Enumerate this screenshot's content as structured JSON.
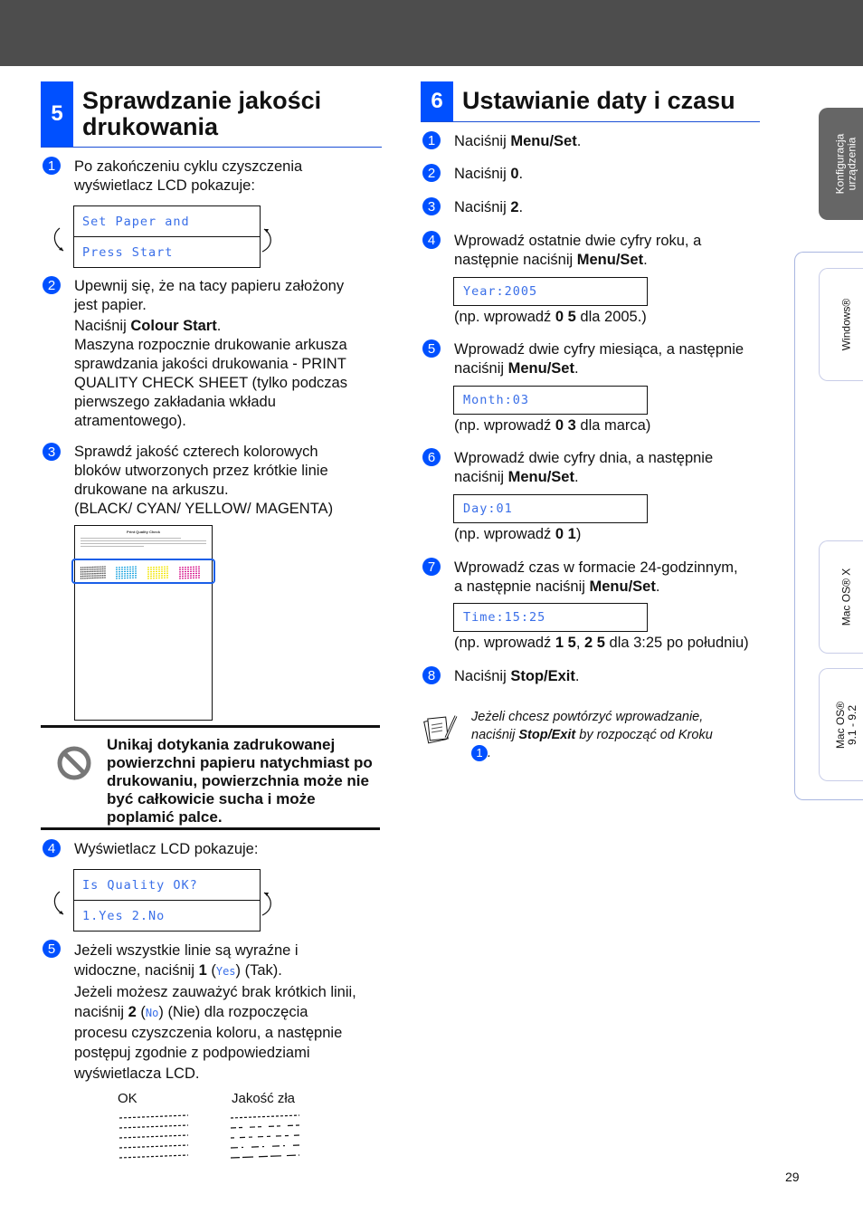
{
  "page_number": "29",
  "section5": {
    "number": "5",
    "title_line1": "Sprawdzanie jakości",
    "title_line2": "drukowania",
    "steps": [
      {
        "badge": "1",
        "lines": [
          "Po zakończeniu cyklu czyszczenia",
          "wyświetlacz LCD pokazuje:"
        ]
      },
      {
        "badge": "2",
        "line1": "Upewnij się, że na tacy papieru założony",
        "line2": "jest papier.",
        "press_prefix": "Naciśnij ",
        "press_key": "Colour Start",
        "press_suffix": ".",
        "rest": [
          "Maszyna rozpocznie drukowanie arkusza",
          "sprawdzania jakości drukowania - PRINT",
          "QUALITY CHECK SHEET (tylko podczas",
          "pierwszego zakładania wkładu",
          "atramentowego)."
        ]
      },
      {
        "badge": "3",
        "lines": [
          "Sprawdź jakość czterech kolorowych",
          "bloków utworzonych przez krótkie linie",
          "drukowane na arkuszu.",
          "(BLACK/ CYAN/ YELLOW/ MAGENTA)"
        ]
      },
      {
        "badge": "4",
        "lines": [
          "Wyświetlacz LCD pokazuje:"
        ]
      },
      {
        "badge": "5",
        "l1": "Jeżeli wszystkie linie są wyraźne i",
        "l2_pre": "widoczne, naciśnij ",
        "l2_key": "1",
        "l2_open": " (",
        "l2_lcd": "Yes",
        "l2_post": ") (Tak).",
        "l3": "Jeżeli możesz zauważyć brak krótkich linii,",
        "l4_pre": "naciśnij ",
        "l4_key": "2",
        "l4_open": " (",
        "l4_lcd": "No",
        "l4_post": ") (Nie) dla rozpoczęcia",
        "l5": "procesu czyszczenia koloru, a następnie",
        "l6": "postępuj zgodnie z podpowiedziami",
        "l7": "wyświetlacza LCD."
      }
    ],
    "lcd1": [
      "Set Paper and",
      "Press Start"
    ],
    "lcd2": [
      "Is Quality OK?",
      "1.Yes 2.No"
    ],
    "sheet_title": "Print Quality Check",
    "warning": [
      "Unikaj dotykania zadrukowanej",
      "powierzchni papieru natychmiast po",
      "drukowaniu, powierzchnia może nie",
      "być całkowicie sucha i może",
      "poplamić palce."
    ],
    "ok_label": "OK",
    "bad_label": "Jakość zła",
    "colors": {
      "black": "#111111",
      "cyan": "#1aa3e0",
      "yellow": "#f2e600",
      "magenta": "#d6148c"
    }
  },
  "section6": {
    "number": "6",
    "title": "Ustawianie daty i czasu",
    "steps": [
      {
        "badge": "1",
        "pre": "Naciśnij ",
        "key": "Menu/Set",
        "post": "."
      },
      {
        "badge": "2",
        "pre": "Naciśnij ",
        "key": "0",
        "post": "."
      },
      {
        "badge": "3",
        "pre": "Naciśnij ",
        "key": "2",
        "post": "."
      },
      {
        "badge": "4",
        "line1": "Wprowadź ostatnie dwie cyfry roku, a",
        "pre": "następnie naciśnij ",
        "key": "Menu/Set",
        "post": ".",
        "lcd": "Year:2005",
        "ex_pre": "(np. wprowadź ",
        "ex_key": "0 5",
        "ex_post": " dla 2005.)"
      },
      {
        "badge": "5",
        "line1": "Wprowadź dwie cyfry miesiąca, a następnie",
        "pre": "naciśnij ",
        "key": "Menu/Set",
        "post": ".",
        "lcd": "Month:03",
        "ex_pre": "(np. wprowadź ",
        "ex_key": "0 3",
        "ex_post": " dla marca)"
      },
      {
        "badge": "6",
        "line1": "Wprowadź dwie cyfry dnia, a następnie",
        "pre": "naciśnij ",
        "key": "Menu/Set",
        "post": ".",
        "lcd": "Day:01",
        "ex_pre": "(np. wprowadź ",
        "ex_key": "0 1",
        "ex_post": ")"
      },
      {
        "badge": "7",
        "line1": "Wprowadź czas w formacie 24-godzinnym,",
        "pre": "a następnie naciśnij ",
        "key": "Menu/Set",
        "post": ".",
        "lcd": "Time:15:25",
        "ex_pre": "(np. wprowadź ",
        "ex_key": "1 5",
        "ex_mid": ", ",
        "ex_key2": "2 5",
        "ex_post": " dla 3:25 po południu)"
      },
      {
        "badge": "8",
        "pre": "Naciśnij ",
        "key": "Stop/Exit",
        "post": "."
      }
    ],
    "tip": {
      "l1": "Jeżeli chcesz powtórzyć wprowadzanie,",
      "l2_pre": "naciśnij ",
      "l2_key": "Stop/Exit",
      "l2_post": " by rozpocząć od Kroku",
      "badge": "1",
      "end": "."
    }
  },
  "side_tabs": [
    {
      "label_lines": [
        "Konfiguracja",
        "urządzenia"
      ],
      "active": true
    },
    {
      "label_lines": [
        "Windows®"
      ],
      "active": false
    },
    {
      "label_lines": [
        "Mac OS® X"
      ],
      "active": false
    },
    {
      "label_lines": [
        "Mac OS®",
        "9.1 - 9.2"
      ],
      "active": false
    }
  ]
}
